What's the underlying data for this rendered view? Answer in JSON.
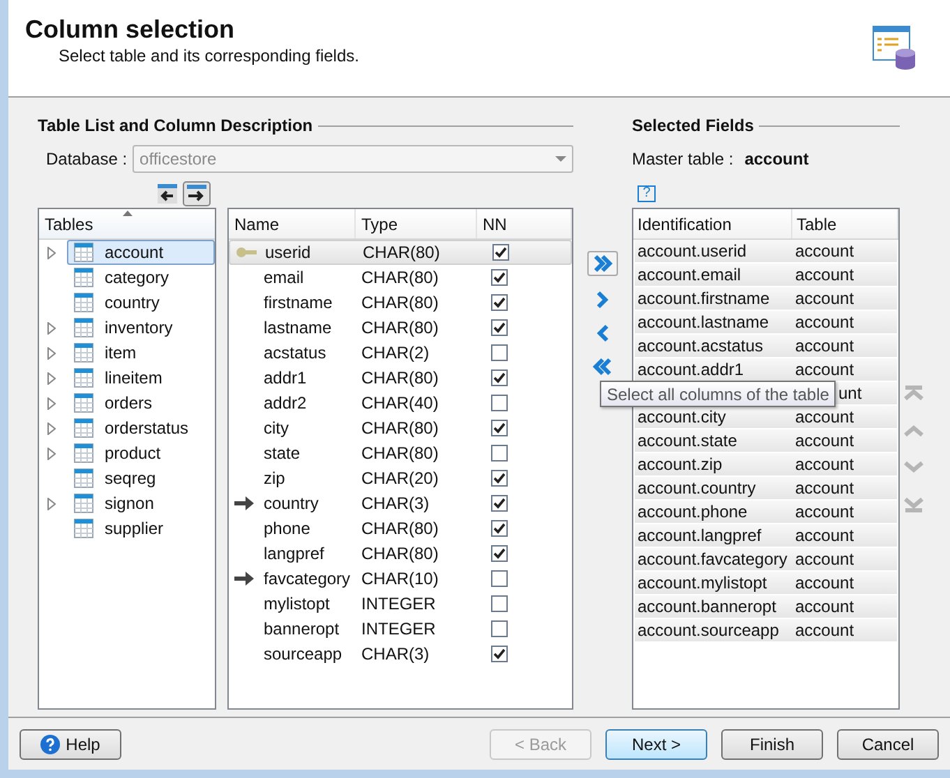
{
  "header": {
    "title": "Column selection",
    "subtitle": "Select table and its corresponding fields."
  },
  "left_section": {
    "heading": "Table List and Column Description",
    "database_label": "Database :",
    "database_value": "officestore",
    "tables_header": "Tables",
    "tables": [
      {
        "name": "account",
        "expandable": true,
        "selected": true
      },
      {
        "name": "category",
        "expandable": false,
        "selected": false
      },
      {
        "name": "country",
        "expandable": false,
        "selected": false
      },
      {
        "name": "inventory",
        "expandable": true,
        "selected": false
      },
      {
        "name": "item",
        "expandable": true,
        "selected": false
      },
      {
        "name": "lineitem",
        "expandable": true,
        "selected": false
      },
      {
        "name": "orders",
        "expandable": true,
        "selected": false
      },
      {
        "name": "orderstatus",
        "expandable": true,
        "selected": false
      },
      {
        "name": "product",
        "expandable": true,
        "selected": false
      },
      {
        "name": "seqreg",
        "expandable": false,
        "selected": false
      },
      {
        "name": "signon",
        "expandable": true,
        "selected": false
      },
      {
        "name": "supplier",
        "expandable": false,
        "selected": false
      }
    ],
    "columns_header": [
      "Name",
      "Type",
      "NN"
    ],
    "columns": [
      {
        "name": "userid",
        "type": "CHAR(80)",
        "nn": true,
        "kind": "key",
        "selected": true
      },
      {
        "name": "email",
        "type": "CHAR(80)",
        "nn": true,
        "kind": "plain",
        "selected": false
      },
      {
        "name": "firstname",
        "type": "CHAR(80)",
        "nn": true,
        "kind": "plain",
        "selected": false
      },
      {
        "name": "lastname",
        "type": "CHAR(80)",
        "nn": true,
        "kind": "plain",
        "selected": false
      },
      {
        "name": "acstatus",
        "type": "CHAR(2)",
        "nn": false,
        "kind": "plain",
        "selected": false
      },
      {
        "name": "addr1",
        "type": "CHAR(80)",
        "nn": true,
        "kind": "plain",
        "selected": false
      },
      {
        "name": "addr2",
        "type": "CHAR(40)",
        "nn": false,
        "kind": "plain",
        "selected": false
      },
      {
        "name": "city",
        "type": "CHAR(80)",
        "nn": true,
        "kind": "plain",
        "selected": false
      },
      {
        "name": "state",
        "type": "CHAR(80)",
        "nn": false,
        "kind": "plain",
        "selected": false
      },
      {
        "name": "zip",
        "type": "CHAR(20)",
        "nn": true,
        "kind": "plain",
        "selected": false
      },
      {
        "name": "country",
        "type": "CHAR(3)",
        "nn": true,
        "kind": "foreign",
        "selected": false
      },
      {
        "name": "phone",
        "type": "CHAR(80)",
        "nn": true,
        "kind": "plain",
        "selected": false
      },
      {
        "name": "langpref",
        "type": "CHAR(80)",
        "nn": true,
        "kind": "plain",
        "selected": false
      },
      {
        "name": "favcategory",
        "type": "CHAR(10)",
        "nn": false,
        "kind": "foreign",
        "selected": false
      },
      {
        "name": "mylistopt",
        "type": "INTEGER",
        "nn": false,
        "kind": "plain",
        "selected": false
      },
      {
        "name": "banneropt",
        "type": "INTEGER",
        "nn": false,
        "kind": "plain",
        "selected": false
      },
      {
        "name": "sourceapp",
        "type": "CHAR(3)",
        "nn": true,
        "kind": "plain",
        "selected": false
      }
    ]
  },
  "tooltip": "Select all columns of the table",
  "right_section": {
    "heading": "Selected Fields",
    "master_label": "Master table :",
    "master_value": "account",
    "help_mark": "?",
    "columns_header": [
      "Identification",
      "Table"
    ],
    "rows": [
      {
        "identification": "account.userid",
        "table": "account"
      },
      {
        "identification": "account.email",
        "table": "account"
      },
      {
        "identification": "account.firstname",
        "table": "account"
      },
      {
        "identification": "account.lastname",
        "table": "account"
      },
      {
        "identification": "account.acstatus",
        "table": "account"
      },
      {
        "identification": "account.addr1",
        "table": "account"
      },
      {
        "table": "unt"
      },
      {
        "identification": "account.city",
        "table": "account"
      },
      {
        "identification": "account.state",
        "table": "account"
      },
      {
        "identification": "account.zip",
        "table": "account"
      },
      {
        "identification": "account.country",
        "table": "account"
      },
      {
        "identification": "account.phone",
        "table": "account"
      },
      {
        "identification": "account.langpref",
        "table": "account"
      },
      {
        "identification": "account.favcategory",
        "table": "account"
      },
      {
        "identification": "account.mylistopt",
        "table": "account"
      },
      {
        "identification": "account.banneropt",
        "table": "account"
      },
      {
        "identification": "account.sourceapp",
        "table": "account"
      }
    ]
  },
  "footer": [
    {
      "label": "Help",
      "kind": "help",
      "disabled": false,
      "default": false
    },
    {
      "label": "< Back",
      "kind": "plain",
      "disabled": true,
      "default": false
    },
    {
      "label": "Next >",
      "kind": "plain",
      "disabled": false,
      "default": true
    },
    {
      "label": "Finish",
      "kind": "plain",
      "disabled": false,
      "default": false
    },
    {
      "label": "Cancel",
      "kind": "plain",
      "disabled": false,
      "default": false
    }
  ]
}
